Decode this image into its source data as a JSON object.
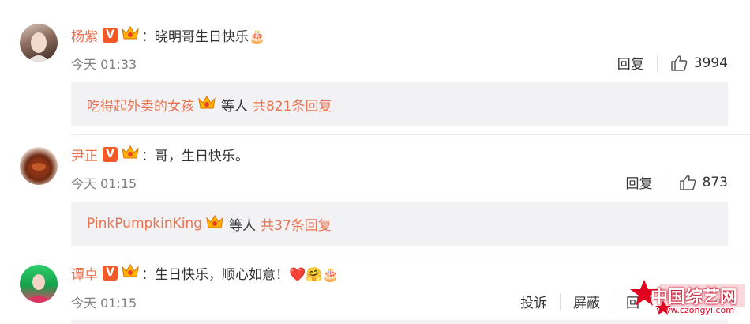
{
  "comments": [
    {
      "username": "杨紫",
      "text": "晓明哥生日快乐🎂",
      "time": "今天 01:33",
      "reply_label": "回复",
      "like_count": "3994",
      "reply_box": {
        "users": "吃得起外卖的女孩",
        "middle": "等人",
        "count": "共821条回复"
      }
    },
    {
      "username": "尹正",
      "text": "哥，生日快乐。",
      "time": "今天 01:15",
      "reply_label": "回复",
      "like_count": "873",
      "reply_box": {
        "users": "PinkPumpkinKing",
        "middle": "等人",
        "count": "共37条回复"
      }
    },
    {
      "username": "谭卓",
      "text": "生日快乐，顺心如意！❤️🤗🎂",
      "time": "今天 01:15",
      "report_label": "投诉",
      "block_label": "屏蔽",
      "reply_label": "回"
    }
  ],
  "separator": "：",
  "verified_badge": "V",
  "watermark": {
    "brand": "中国综艺网",
    "url": "www.czongyi.com"
  },
  "colors": {
    "accent": "#eb7350",
    "badge": "#f05a28",
    "reply_bg": "#f2f2f5"
  }
}
